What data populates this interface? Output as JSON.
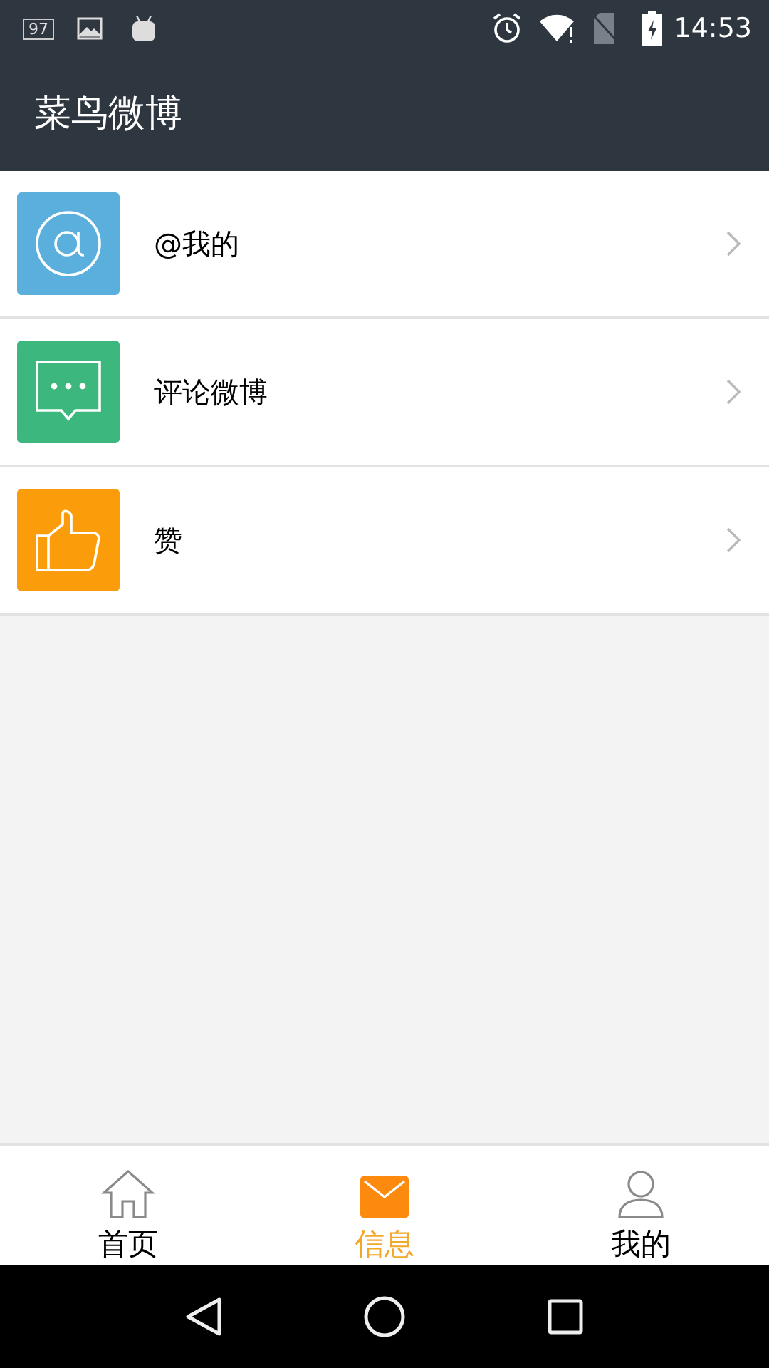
{
  "status_bar": {
    "notification_badge": "97",
    "time": "14:53"
  },
  "app_bar": {
    "title": "菜鸟微博"
  },
  "items": [
    {
      "kind": "mention",
      "label": "@我的",
      "color": "#5aafdc"
    },
    {
      "kind": "comment",
      "label": "评论微博",
      "color": "#3cb77e"
    },
    {
      "kind": "like",
      "label": "赞",
      "color": "#fb9d0b"
    }
  ],
  "tabs": [
    {
      "kind": "home",
      "label": "首页",
      "selected": false
    },
    {
      "kind": "mail",
      "label": "信息",
      "selected": true
    },
    {
      "kind": "person",
      "label": "我的",
      "selected": false
    }
  ]
}
